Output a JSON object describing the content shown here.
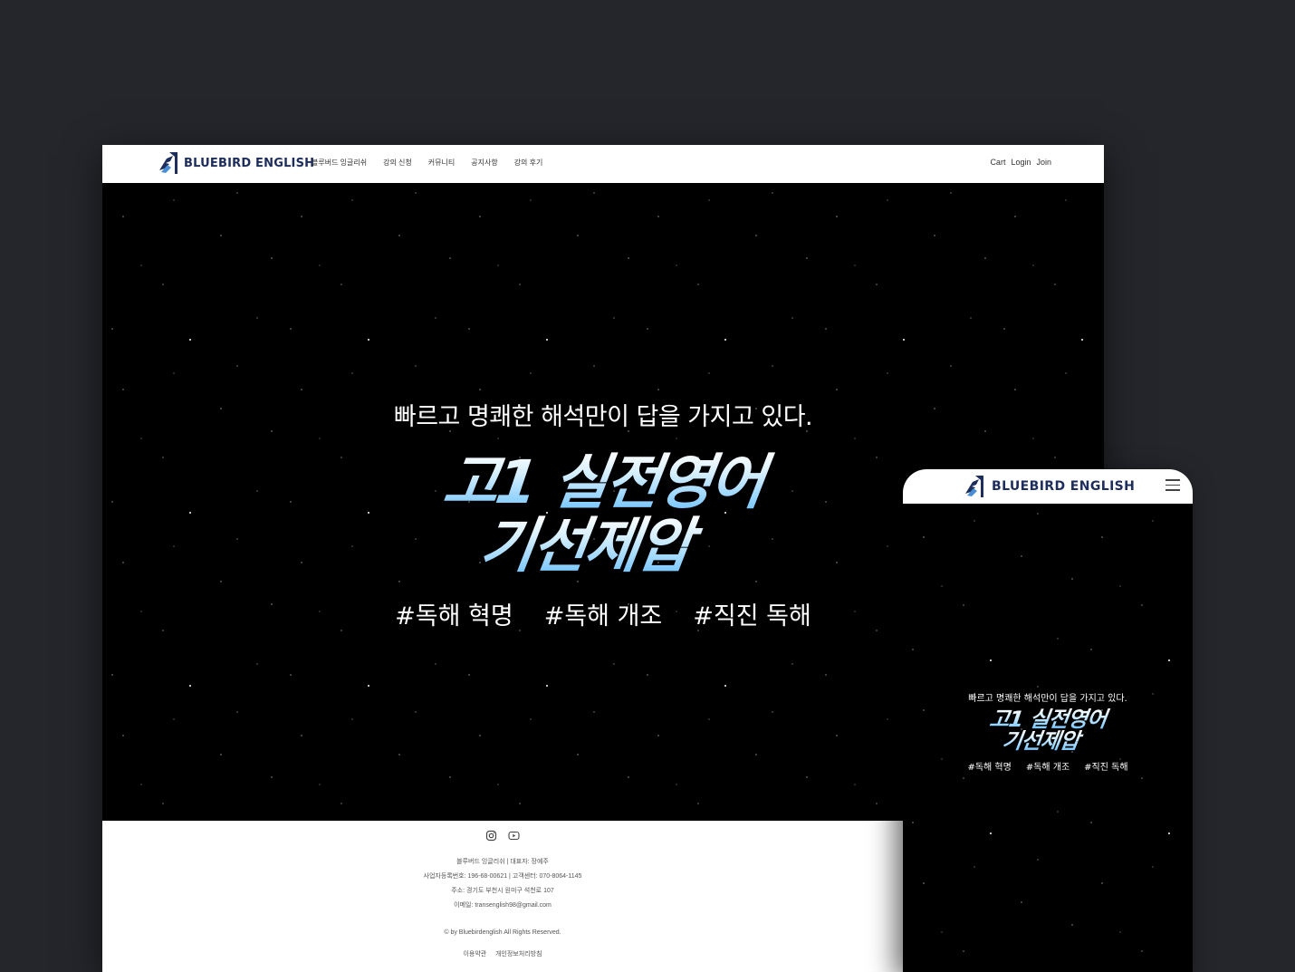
{
  "brand": "BLUEBIRD ENGLISH",
  "colors": {
    "brand_navy": "#1d2d5c",
    "accent_blue": "#6cc2ff",
    "page_bg": "#24262b"
  },
  "desktop": {
    "nav": [
      "블루버드 잉글리쉬",
      "강의 신청",
      "커뮤니티",
      "공지사항",
      "강의 후기"
    ],
    "util": [
      "Cart",
      "Login",
      "Join"
    ],
    "hero": {
      "subtitle": "빠르고 명쾌한 해석만이 답을 가지고 있다.",
      "title_line1": "고1 실전영어",
      "title_line2": "기선제압",
      "tags": [
        "#독해 혁명",
        "#독해 개조",
        "#직진 독해"
      ]
    },
    "footer": {
      "icons": [
        "instagram-icon",
        "youtube-icon"
      ],
      "company": "블루버드 잉글리쉬 | 대표자: 장예주",
      "business": "사업자등록번호: 196-68-00621 | 고객센터: 070-8064-1145",
      "address": "주소: 경기도 부천시 원미구 석천로 107",
      "email": "이메일: transenglish98@gmail.com",
      "copyright": "© by Bluebirdenglish All Rights Reserved.",
      "links": [
        "이용약관",
        "개인정보처리방침"
      ]
    }
  },
  "mobile": {
    "hero": {
      "subtitle": "빠르고 명쾌한 해석만이 답을 가지고 있다.",
      "title_line1": "고1 실전영어",
      "title_line2": "기선제압",
      "tags": [
        "#독해 혁명",
        "#독해 개조",
        "#직진 독해"
      ]
    }
  }
}
